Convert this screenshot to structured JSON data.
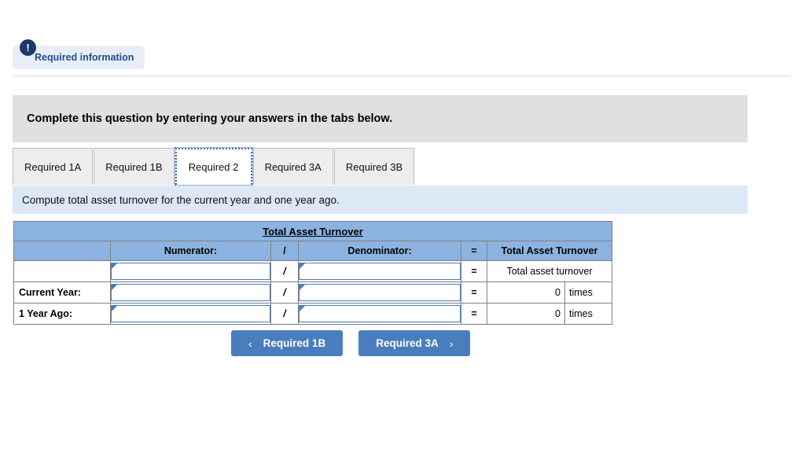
{
  "page": {
    "clipped_top_text": "",
    "clipped_mid_text": ""
  },
  "required_info": {
    "icon": "exclamation-icon",
    "bang": "!",
    "label": "Required information"
  },
  "banner": {
    "text": "Complete this question by entering your answers in the tabs below."
  },
  "tabs": {
    "items": [
      {
        "label": "Required 1A",
        "active": false
      },
      {
        "label": "Required 1B",
        "active": false
      },
      {
        "label": "Required 2",
        "active": true
      },
      {
        "label": "Required 3A",
        "active": false
      },
      {
        "label": "Required 3B",
        "active": false
      }
    ]
  },
  "instruction": {
    "text": "Compute total asset turnover for the current year and one year ago."
  },
  "table": {
    "title": "Total Asset Turnover",
    "columns": {
      "label": "",
      "numerator": "Numerator:",
      "slash": "/",
      "denominator": "Denominator:",
      "equals": "=",
      "result": "Total Asset Turnover"
    },
    "rows": [
      {
        "label": "",
        "numerator": "",
        "slash": "/",
        "denominator": "",
        "equals": "=",
        "result_text": "Total asset turnover",
        "result_value": "",
        "result_unit": ""
      },
      {
        "label": "Current Year:",
        "numerator": "",
        "slash": "/",
        "denominator": "",
        "equals": "=",
        "result_text": "",
        "result_value": "0",
        "result_unit": "times"
      },
      {
        "label": "1 Year Ago:",
        "numerator": "",
        "slash": "/",
        "denominator": "",
        "equals": "=",
        "result_text": "",
        "result_value": "0",
        "result_unit": "times"
      }
    ]
  },
  "nav": {
    "prev_chevron": "‹",
    "prev_label": "Required 1B",
    "next_label": "Required 3A",
    "next_chevron": "›"
  },
  "colors": {
    "button_blue": "#4a7dbd",
    "header_blue": "#8cb3e0",
    "instruction_blue": "#dce8f5",
    "banner_gray": "#e0e0e0",
    "badge_navy": "#1b3a6b",
    "badge_pill": "#e8eef7"
  }
}
